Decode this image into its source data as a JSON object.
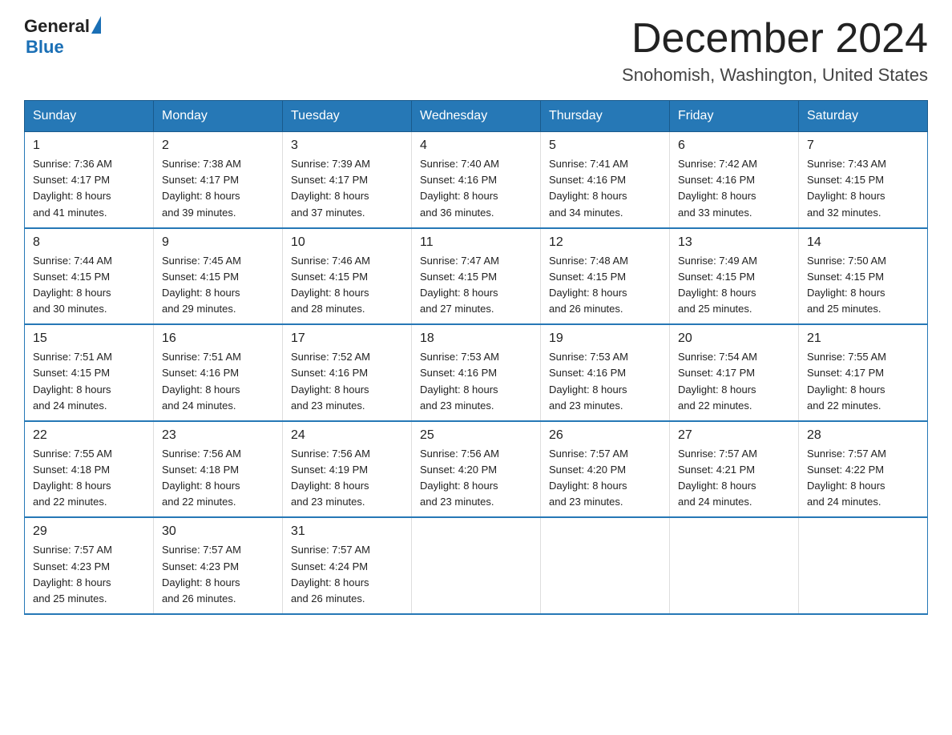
{
  "header": {
    "logo_line1": "General",
    "logo_line2": "Blue",
    "title": "December 2024",
    "subtitle": "Snohomish, Washington, United States"
  },
  "weekdays": [
    "Sunday",
    "Monday",
    "Tuesday",
    "Wednesday",
    "Thursday",
    "Friday",
    "Saturday"
  ],
  "weeks": [
    [
      {
        "day": "1",
        "info": "Sunrise: 7:36 AM\nSunset: 4:17 PM\nDaylight: 8 hours\nand 41 minutes."
      },
      {
        "day": "2",
        "info": "Sunrise: 7:38 AM\nSunset: 4:17 PM\nDaylight: 8 hours\nand 39 minutes."
      },
      {
        "day": "3",
        "info": "Sunrise: 7:39 AM\nSunset: 4:17 PM\nDaylight: 8 hours\nand 37 minutes."
      },
      {
        "day": "4",
        "info": "Sunrise: 7:40 AM\nSunset: 4:16 PM\nDaylight: 8 hours\nand 36 minutes."
      },
      {
        "day": "5",
        "info": "Sunrise: 7:41 AM\nSunset: 4:16 PM\nDaylight: 8 hours\nand 34 minutes."
      },
      {
        "day": "6",
        "info": "Sunrise: 7:42 AM\nSunset: 4:16 PM\nDaylight: 8 hours\nand 33 minutes."
      },
      {
        "day": "7",
        "info": "Sunrise: 7:43 AM\nSunset: 4:15 PM\nDaylight: 8 hours\nand 32 minutes."
      }
    ],
    [
      {
        "day": "8",
        "info": "Sunrise: 7:44 AM\nSunset: 4:15 PM\nDaylight: 8 hours\nand 30 minutes."
      },
      {
        "day": "9",
        "info": "Sunrise: 7:45 AM\nSunset: 4:15 PM\nDaylight: 8 hours\nand 29 minutes."
      },
      {
        "day": "10",
        "info": "Sunrise: 7:46 AM\nSunset: 4:15 PM\nDaylight: 8 hours\nand 28 minutes."
      },
      {
        "day": "11",
        "info": "Sunrise: 7:47 AM\nSunset: 4:15 PM\nDaylight: 8 hours\nand 27 minutes."
      },
      {
        "day": "12",
        "info": "Sunrise: 7:48 AM\nSunset: 4:15 PM\nDaylight: 8 hours\nand 26 minutes."
      },
      {
        "day": "13",
        "info": "Sunrise: 7:49 AM\nSunset: 4:15 PM\nDaylight: 8 hours\nand 25 minutes."
      },
      {
        "day": "14",
        "info": "Sunrise: 7:50 AM\nSunset: 4:15 PM\nDaylight: 8 hours\nand 25 minutes."
      }
    ],
    [
      {
        "day": "15",
        "info": "Sunrise: 7:51 AM\nSunset: 4:15 PM\nDaylight: 8 hours\nand 24 minutes."
      },
      {
        "day": "16",
        "info": "Sunrise: 7:51 AM\nSunset: 4:16 PM\nDaylight: 8 hours\nand 24 minutes."
      },
      {
        "day": "17",
        "info": "Sunrise: 7:52 AM\nSunset: 4:16 PM\nDaylight: 8 hours\nand 23 minutes."
      },
      {
        "day": "18",
        "info": "Sunrise: 7:53 AM\nSunset: 4:16 PM\nDaylight: 8 hours\nand 23 minutes."
      },
      {
        "day": "19",
        "info": "Sunrise: 7:53 AM\nSunset: 4:16 PM\nDaylight: 8 hours\nand 23 minutes."
      },
      {
        "day": "20",
        "info": "Sunrise: 7:54 AM\nSunset: 4:17 PM\nDaylight: 8 hours\nand 22 minutes."
      },
      {
        "day": "21",
        "info": "Sunrise: 7:55 AM\nSunset: 4:17 PM\nDaylight: 8 hours\nand 22 minutes."
      }
    ],
    [
      {
        "day": "22",
        "info": "Sunrise: 7:55 AM\nSunset: 4:18 PM\nDaylight: 8 hours\nand 22 minutes."
      },
      {
        "day": "23",
        "info": "Sunrise: 7:56 AM\nSunset: 4:18 PM\nDaylight: 8 hours\nand 22 minutes."
      },
      {
        "day": "24",
        "info": "Sunrise: 7:56 AM\nSunset: 4:19 PM\nDaylight: 8 hours\nand 23 minutes."
      },
      {
        "day": "25",
        "info": "Sunrise: 7:56 AM\nSunset: 4:20 PM\nDaylight: 8 hours\nand 23 minutes."
      },
      {
        "day": "26",
        "info": "Sunrise: 7:57 AM\nSunset: 4:20 PM\nDaylight: 8 hours\nand 23 minutes."
      },
      {
        "day": "27",
        "info": "Sunrise: 7:57 AM\nSunset: 4:21 PM\nDaylight: 8 hours\nand 24 minutes."
      },
      {
        "day": "28",
        "info": "Sunrise: 7:57 AM\nSunset: 4:22 PM\nDaylight: 8 hours\nand 24 minutes."
      }
    ],
    [
      {
        "day": "29",
        "info": "Sunrise: 7:57 AM\nSunset: 4:23 PM\nDaylight: 8 hours\nand 25 minutes."
      },
      {
        "day": "30",
        "info": "Sunrise: 7:57 AM\nSunset: 4:23 PM\nDaylight: 8 hours\nand 26 minutes."
      },
      {
        "day": "31",
        "info": "Sunrise: 7:57 AM\nSunset: 4:24 PM\nDaylight: 8 hours\nand 26 minutes."
      },
      null,
      null,
      null,
      null
    ]
  ]
}
